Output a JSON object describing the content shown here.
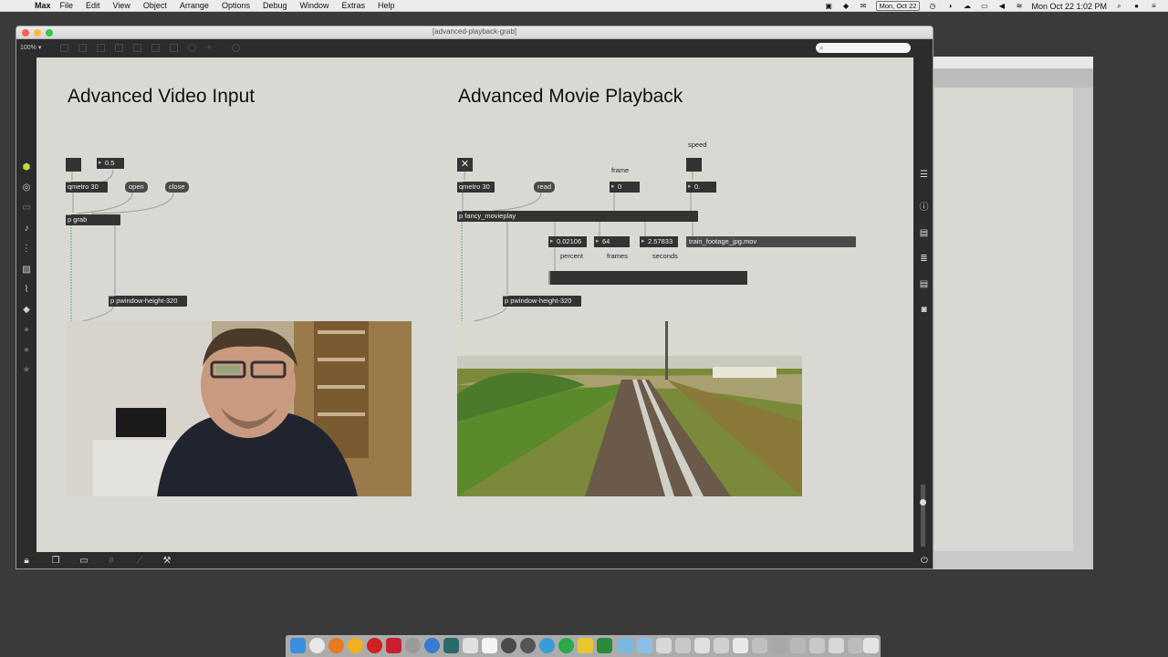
{
  "menubar": {
    "app_name": "Max",
    "items": [
      "File",
      "Edit",
      "View",
      "Object",
      "Arrange",
      "Options",
      "Debug",
      "Window",
      "Extras",
      "Help"
    ],
    "date_pill": "Mon, Oct 22",
    "clock": "Mon Oct 22  1:02 PM"
  },
  "window": {
    "title": "[advanced-playback-grab]",
    "zoom": "100%",
    "search_placeholder": ""
  },
  "patcher": {
    "left": {
      "heading": "Advanced Video Input",
      "number_box": "0.5",
      "qmetro": "qmetro 30",
      "open_msg": "open",
      "close_msg": "close",
      "grab_object": "p grab",
      "pwindow_object": "p pwindow-height-320"
    },
    "right": {
      "heading": "Advanced Movie Playback",
      "speed_label": "speed",
      "frame_label": "frame",
      "qmetro": "qmetro 30",
      "read_msg": "read",
      "frame_number": "0",
      "speed_number": "0.",
      "movieplay_object": "p fancy_movieplay",
      "percent_value": "0.02106",
      "frames_value": "64",
      "seconds_value": "2.57833",
      "filename": "train_footage_jpg.mov",
      "percent_label": "percent",
      "frames_label": "frames",
      "seconds_label": "seconds",
      "pwindow_object": "p pwindow-height-320"
    }
  },
  "icons": {
    "left_toolbar": [
      "cube-icon",
      "target-icon",
      "dash-icon",
      "music-note-icon",
      "step-icon",
      "image-icon",
      "paperclip-icon",
      "plugin-icon",
      "circle-icon",
      "circle-icon",
      "star-icon"
    ],
    "right_toolbar": [
      "list-icon",
      "info-icon",
      "book-icon",
      "list-icon",
      "book-icon",
      "camera-icon"
    ],
    "bottom_toolbar": [
      "lock-icon",
      "windows-icon",
      "presentation-icon",
      "grid-icon",
      "wand-icon",
      "wrench-icon",
      "power-icon"
    ]
  },
  "colors": {
    "canvas": "#d9d9d4",
    "object": "#333333",
    "toolbar": "#2c2c2c",
    "cord": "#9a9a9a",
    "signal_cord": "#6da66d"
  }
}
